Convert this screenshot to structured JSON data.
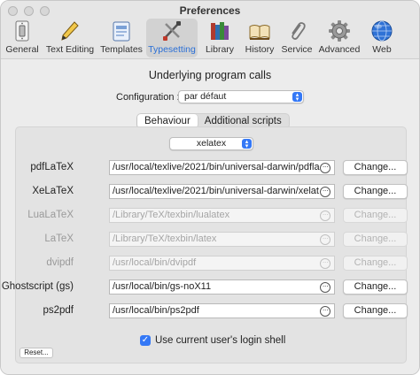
{
  "window": {
    "title": "Preferences"
  },
  "toolbar": {
    "items": [
      {
        "label": "General",
        "icon": "light-switch-icon"
      },
      {
        "label": "Text Editing",
        "icon": "pen-icon"
      },
      {
        "label": "Templates",
        "icon": "templates-icon"
      },
      {
        "label": "Typesetting",
        "icon": "typesetting-tools-icon"
      },
      {
        "label": "Library",
        "icon": "books-icon"
      },
      {
        "label": "History",
        "icon": "open-book-icon"
      },
      {
        "label": "Service",
        "icon": "paperclip-icon"
      },
      {
        "label": "Advanced",
        "icon": "gear-icon"
      },
      {
        "label": "Web",
        "icon": "globe-icon"
      }
    ],
    "selected": "Typesetting",
    "accent_color": "#2a6fd6"
  },
  "main": {
    "heading": "Underlying program calls",
    "configuration_label": "Configuration :",
    "configuration_value": "par défaut",
    "tabs": [
      "Behaviour",
      "Additional scripts"
    ],
    "active_tab": "Behaviour",
    "engine_value": "xelatex",
    "rows": [
      {
        "label": "pdfLaTeX",
        "path": "/usr/local/texlive/2021/bin/universal-darwin/pdfla",
        "button": "Change...",
        "enabled": true
      },
      {
        "label": "XeLaTeX",
        "path": "/usr/local/texlive/2021/bin/universal-darwin/xelat",
        "button": "Change...",
        "enabled": true
      },
      {
        "label": "LuaLaTeX",
        "path": "/Library/TeX/texbin/lualatex",
        "button": "Change...",
        "enabled": false
      },
      {
        "label": "LaTeX",
        "path": "/Library/TeX/texbin/latex",
        "button": "Change...",
        "enabled": false
      },
      {
        "label": "dvipdf",
        "path": "/usr/local/bin/dvipdf",
        "button": "Change...",
        "enabled": false
      },
      {
        "label": "Ghostscript (gs)",
        "path": "/usr/local/bin/gs-noX11",
        "button": "Change...",
        "enabled": true
      },
      {
        "label": "ps2pdf",
        "path": "/usr/local/bin/ps2pdf",
        "button": "Change...",
        "enabled": true
      }
    ],
    "checkbox_label": "Use current user's login shell",
    "checkbox_checked": true,
    "reset_label": "Reset..."
  }
}
